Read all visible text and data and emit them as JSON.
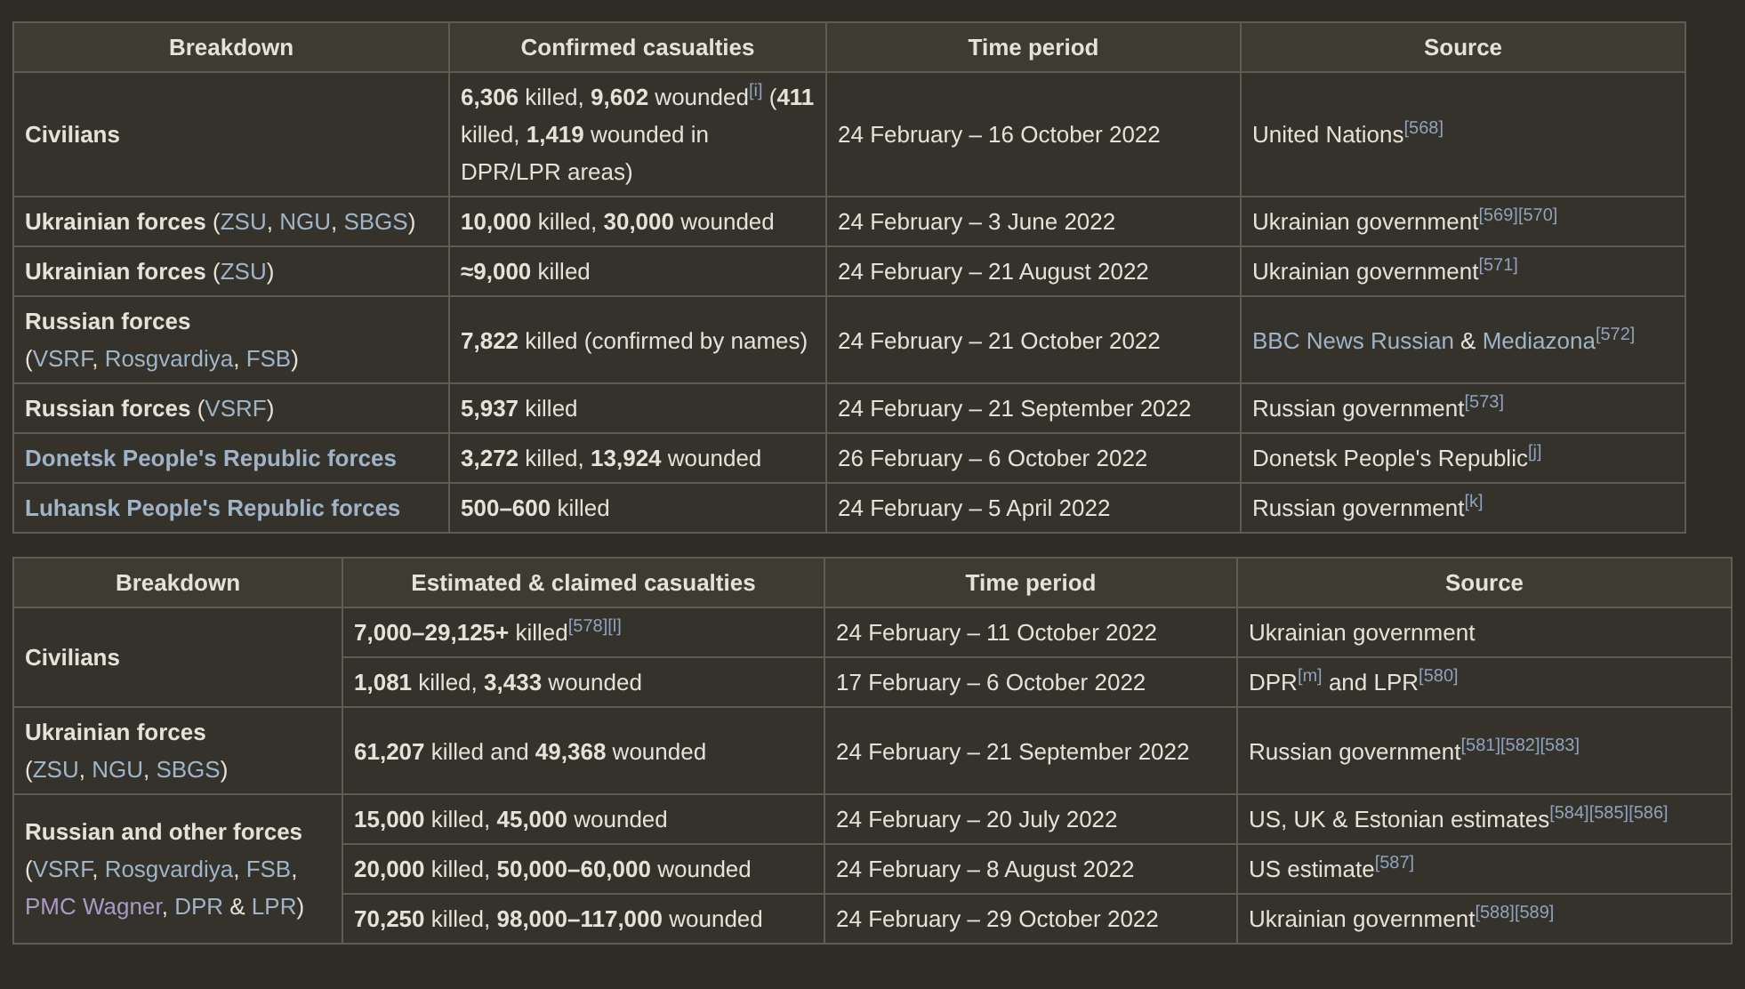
{
  "tables": [
    {
      "columns": [
        "Breakdown",
        "Confirmed casualties",
        "Time period",
        "Source"
      ],
      "groups": [
        {
          "breakdown": [
            [
              {
                "t": "Civilians",
                "kind": "bold"
              }
            ]
          ],
          "rows": [
            {
              "casualties": [
                {
                  "t": "6,306",
                  "kind": "bold"
                },
                {
                  "t": " killed, ",
                  "kind": "text"
                },
                {
                  "t": "9,602",
                  "kind": "bold"
                },
                {
                  "t": " wounded",
                  "kind": "text"
                },
                {
                  "t": "[i]",
                  "kind": "ref"
                },
                {
                  "t": " (",
                  "kind": "text"
                },
                {
                  "t": "411",
                  "kind": "bold"
                },
                {
                  "t": " killed, ",
                  "kind": "text"
                },
                {
                  "t": "1,419",
                  "kind": "bold"
                },
                {
                  "t": " wounded in DPR/LPR areas)",
                  "kind": "text"
                }
              ],
              "period": "24 February – 16 October 2022",
              "source": [
                {
                  "t": "United Nations",
                  "kind": "text"
                },
                {
                  "t": "[568]",
                  "kind": "ref"
                }
              ]
            }
          ]
        },
        {
          "breakdown": [
            [
              {
                "t": "Ukrainian forces",
                "kind": "bold"
              },
              {
                "t": " (",
                "kind": "text"
              },
              {
                "t": "ZSU",
                "kind": "link"
              },
              {
                "t": ", ",
                "kind": "text"
              },
              {
                "t": "NGU",
                "kind": "link"
              },
              {
                "t": ", ",
                "kind": "text"
              },
              {
                "t": "SBGS",
                "kind": "link"
              },
              {
                "t": ")",
                "kind": "text"
              }
            ]
          ],
          "rows": [
            {
              "casualties": [
                {
                  "t": "10,000",
                  "kind": "bold"
                },
                {
                  "t": " killed, ",
                  "kind": "text"
                },
                {
                  "t": "30,000",
                  "kind": "bold"
                },
                {
                  "t": " wounded",
                  "kind": "text"
                }
              ],
              "period": "24 February – 3 June 2022",
              "source": [
                {
                  "t": "Ukrainian government",
                  "kind": "text"
                },
                {
                  "t": "[569]",
                  "kind": "ref"
                },
                {
                  "t": "[570]",
                  "kind": "ref"
                }
              ]
            }
          ]
        },
        {
          "breakdown": [
            [
              {
                "t": "Ukrainian forces",
                "kind": "bold"
              },
              {
                "t": " (",
                "kind": "text"
              },
              {
                "t": "ZSU",
                "kind": "link"
              },
              {
                "t": ")",
                "kind": "text"
              }
            ]
          ],
          "rows": [
            {
              "casualties": [
                {
                  "t": "≈9,000",
                  "kind": "bold"
                },
                {
                  "t": " killed",
                  "kind": "text"
                }
              ],
              "period": "24 February – 21 August 2022",
              "source": [
                {
                  "t": "Ukrainian government",
                  "kind": "text"
                },
                {
                  "t": "[571]",
                  "kind": "ref"
                }
              ]
            }
          ]
        },
        {
          "breakdown": [
            [
              {
                "t": "Russian forces",
                "kind": "bold"
              }
            ],
            [
              {
                "t": "(",
                "kind": "text"
              },
              {
                "t": "VSRF",
                "kind": "link"
              },
              {
                "t": ", ",
                "kind": "text"
              },
              {
                "t": "Rosgvardiya",
                "kind": "link"
              },
              {
                "t": ", ",
                "kind": "text"
              },
              {
                "t": "FSB",
                "kind": "link"
              },
              {
                "t": ")",
                "kind": "text"
              }
            ]
          ],
          "rows": [
            {
              "casualties": [
                {
                  "t": "7,822",
                  "kind": "bold"
                },
                {
                  "t": " killed (confirmed by names)",
                  "kind": "text"
                }
              ],
              "period": "24 February – 21 October 2022",
              "source": [
                {
                  "t": "BBC News Russian",
                  "kind": "link"
                },
                {
                  "t": " & ",
                  "kind": "text"
                },
                {
                  "t": "Mediazona",
                  "kind": "link"
                },
                {
                  "t": "[572]",
                  "kind": "ref"
                }
              ]
            }
          ]
        },
        {
          "breakdown": [
            [
              {
                "t": "Russian forces",
                "kind": "bold"
              },
              {
                "t": " (",
                "kind": "text"
              },
              {
                "t": "VSRF",
                "kind": "link"
              },
              {
                "t": ")",
                "kind": "text"
              }
            ]
          ],
          "rows": [
            {
              "casualties": [
                {
                  "t": "5,937",
                  "kind": "bold"
                },
                {
                  "t": " killed",
                  "kind": "text"
                }
              ],
              "period": "24 February – 21 September 2022",
              "source": [
                {
                  "t": "Russian government",
                  "kind": "text"
                },
                {
                  "t": "[573]",
                  "kind": "ref"
                }
              ]
            }
          ]
        },
        {
          "breakdown": [
            [
              {
                "t": "Donetsk People's Republic forces",
                "kind": "boldlink"
              }
            ]
          ],
          "rows": [
            {
              "casualties": [
                {
                  "t": "3,272",
                  "kind": "bold"
                },
                {
                  "t": " killed, ",
                  "kind": "text"
                },
                {
                  "t": "13,924",
                  "kind": "bold"
                },
                {
                  "t": " wounded",
                  "kind": "text"
                }
              ],
              "period": "26 February – 6 October 2022",
              "source": [
                {
                  "t": "Donetsk People's Republic",
                  "kind": "text"
                },
                {
                  "t": "[j]",
                  "kind": "ref"
                }
              ]
            }
          ]
        },
        {
          "breakdown": [
            [
              {
                "t": "Luhansk People's Republic forces",
                "kind": "boldlink"
              }
            ]
          ],
          "rows": [
            {
              "casualties": [
                {
                  "t": "500–600",
                  "kind": "bold"
                },
                {
                  "t": " killed",
                  "kind": "text"
                }
              ],
              "period": "24 February – 5 April 2022",
              "source": [
                {
                  "t": "Russian government",
                  "kind": "text"
                },
                {
                  "t": "[k]",
                  "kind": "ref"
                }
              ]
            }
          ]
        }
      ]
    },
    {
      "columns": [
        "Breakdown",
        "Estimated & claimed casualties",
        "Time period",
        "Source"
      ],
      "groups": [
        {
          "breakdown": [
            [
              {
                "t": "Civilians",
                "kind": "bold"
              }
            ]
          ],
          "rows": [
            {
              "casualties": [
                {
                  "t": "7,000–29,125+",
                  "kind": "bold"
                },
                {
                  "t": " killed",
                  "kind": "text"
                },
                {
                  "t": "[578]",
                  "kind": "ref"
                },
                {
                  "t": "[l]",
                  "kind": "ref"
                }
              ],
              "period": "24 February – 11 October 2022",
              "source": [
                {
                  "t": "Ukrainian government",
                  "kind": "text"
                }
              ]
            },
            {
              "casualties": [
                {
                  "t": "1,081",
                  "kind": "bold"
                },
                {
                  "t": " killed, ",
                  "kind": "text"
                },
                {
                  "t": "3,433",
                  "kind": "bold"
                },
                {
                  "t": " wounded",
                  "kind": "text"
                }
              ],
              "period": "17 February – 6 October 2022",
              "source": [
                {
                  "t": "DPR",
                  "kind": "text"
                },
                {
                  "t": "[m]",
                  "kind": "ref"
                },
                {
                  "t": " and LPR",
                  "kind": "text"
                },
                {
                  "t": "[580]",
                  "kind": "ref"
                }
              ]
            }
          ]
        },
        {
          "breakdown": [
            [
              {
                "t": "Ukrainian forces",
                "kind": "bold"
              }
            ],
            [
              {
                "t": "(",
                "kind": "text"
              },
              {
                "t": "ZSU",
                "kind": "link"
              },
              {
                "t": ", ",
                "kind": "text"
              },
              {
                "t": "NGU",
                "kind": "link"
              },
              {
                "t": ", ",
                "kind": "text"
              },
              {
                "t": "SBGS",
                "kind": "link"
              },
              {
                "t": ")",
                "kind": "text"
              }
            ]
          ],
          "rows": [
            {
              "casualties": [
                {
                  "t": "61,207",
                  "kind": "bold"
                },
                {
                  "t": " killed and ",
                  "kind": "text"
                },
                {
                  "t": "49,368",
                  "kind": "bold"
                },
                {
                  "t": " wounded",
                  "kind": "text"
                }
              ],
              "period": "24 February – 21 September 2022",
              "source": [
                {
                  "t": "Russian government",
                  "kind": "text"
                },
                {
                  "t": "[581]",
                  "kind": "ref"
                },
                {
                  "t": "[582]",
                  "kind": "ref"
                },
                {
                  "t": "[583]",
                  "kind": "ref"
                }
              ]
            }
          ]
        },
        {
          "breakdown": [
            [
              {
                "t": "Russian and other forces",
                "kind": "bold"
              }
            ],
            [
              {
                "t": "(",
                "kind": "text"
              },
              {
                "t": "VSRF",
                "kind": "link"
              },
              {
                "t": ", ",
                "kind": "text"
              },
              {
                "t": "Rosgvardiya",
                "kind": "link"
              },
              {
                "t": ", ",
                "kind": "text"
              },
              {
                "t": "FSB",
                "kind": "link"
              },
              {
                "t": ", ",
                "kind": "text"
              },
              {
                "t": "PMC Wagner",
                "kind": "visited"
              },
              {
                "t": ", ",
                "kind": "text"
              },
              {
                "t": "DPR",
                "kind": "link"
              },
              {
                "t": " & ",
                "kind": "text"
              },
              {
                "t": "LPR",
                "kind": "link"
              },
              {
                "t": ")",
                "kind": "text"
              }
            ]
          ],
          "rows": [
            {
              "casualties": [
                {
                  "t": "15,000",
                  "kind": "bold"
                },
                {
                  "t": " killed, ",
                  "kind": "text"
                },
                {
                  "t": "45,000",
                  "kind": "bold"
                },
                {
                  "t": " wounded",
                  "kind": "text"
                }
              ],
              "period": "24 February – 20 July 2022",
              "source": [
                {
                  "t": "US, UK & Estonian estimates",
                  "kind": "text"
                },
                {
                  "t": "[584]",
                  "kind": "ref"
                },
                {
                  "t": "[585]",
                  "kind": "ref"
                },
                {
                  "t": "[586]",
                  "kind": "ref"
                }
              ]
            },
            {
              "casualties": [
                {
                  "t": "20,000",
                  "kind": "bold"
                },
                {
                  "t": " killed, ",
                  "kind": "text"
                },
                {
                  "t": "50,000–60,000",
                  "kind": "bold"
                },
                {
                  "t": " wounded",
                  "kind": "text"
                }
              ],
              "period": "24 February – 8 August 2022",
              "source": [
                {
                  "t": "US estimate",
                  "kind": "text"
                },
                {
                  "t": "[587]",
                  "kind": "ref"
                }
              ]
            },
            {
              "casualties": [
                {
                  "t": "70,250",
                  "kind": "bold"
                },
                {
                  "t": " killed, ",
                  "kind": "text"
                },
                {
                  "t": "98,000–117,000",
                  "kind": "bold"
                },
                {
                  "t": " wounded",
                  "kind": "text"
                }
              ],
              "period": "24 February – 29 October 2022",
              "source": [
                {
                  "t": "Ukrainian government",
                  "kind": "text"
                },
                {
                  "t": "[588]",
                  "kind": "ref"
                },
                {
                  "t": "[589]",
                  "kind": "ref"
                }
              ]
            }
          ]
        }
      ]
    }
  ]
}
